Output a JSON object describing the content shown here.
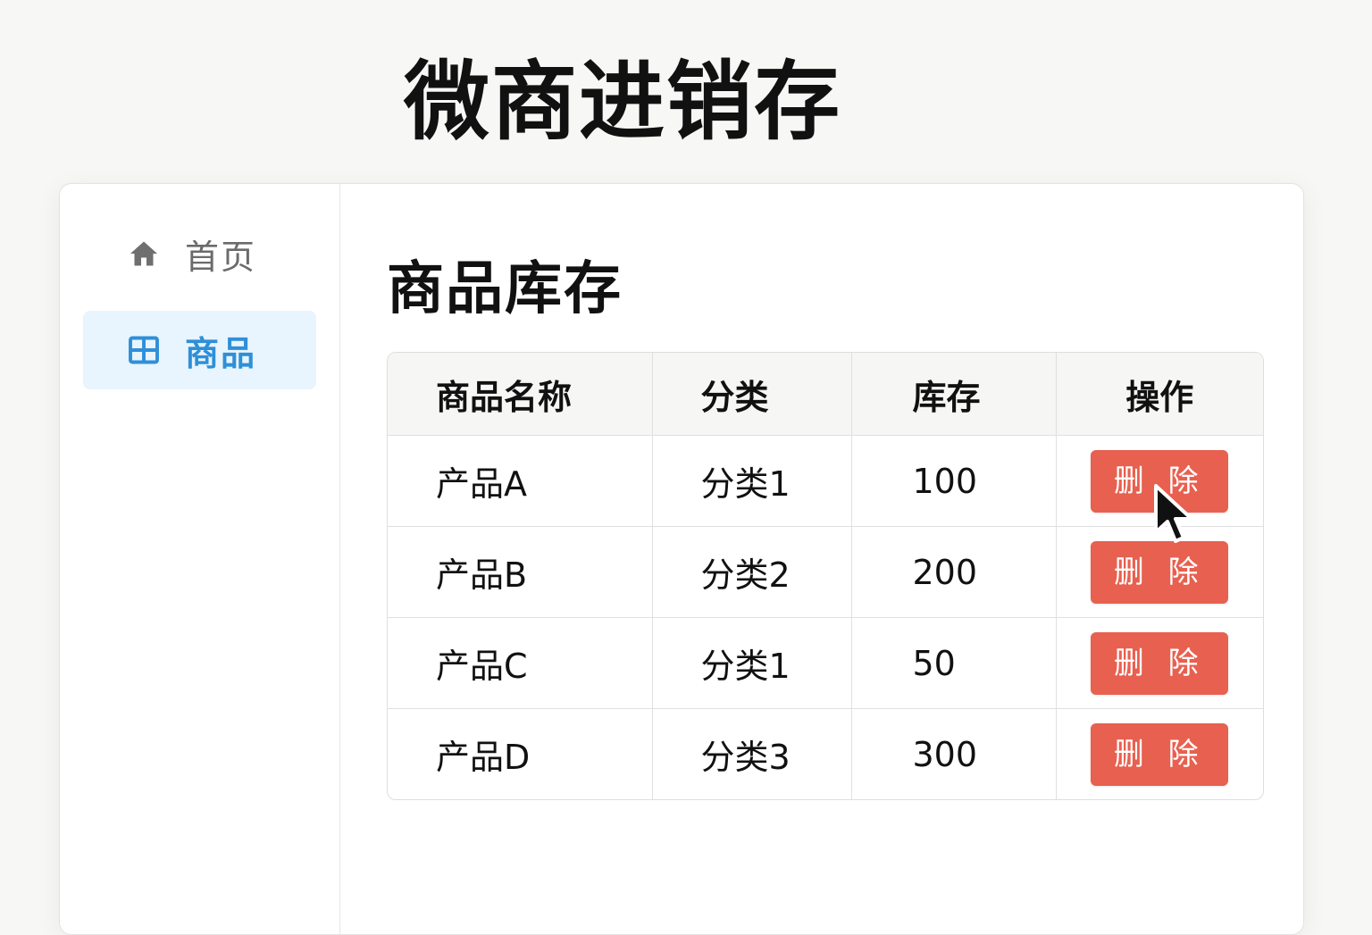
{
  "app": {
    "title": "微商进销存"
  },
  "sidebar": {
    "items": [
      {
        "label": "首页",
        "icon": "home-icon",
        "active": false
      },
      {
        "label": "商品",
        "icon": "grid-icon",
        "active": true
      }
    ]
  },
  "main": {
    "title": "商品库存",
    "table": {
      "headers": [
        "商品名称",
        "分类",
        "库存",
        "操作"
      ],
      "rows": [
        {
          "name": "产品A",
          "category": "分类1",
          "stock": "100",
          "action": "删 除"
        },
        {
          "name": "产品B",
          "category": "分类2",
          "stock": "200",
          "action": "删 除"
        },
        {
          "name": "产品C",
          "category": "分类1",
          "stock": "50",
          "action": "删 除"
        },
        {
          "name": "产品D",
          "category": "分类3",
          "stock": "300",
          "action": "删 除"
        }
      ]
    }
  },
  "colors": {
    "accent": "#2f8fd8",
    "active_bg": "#e8f4fe",
    "danger": "#e8604f"
  }
}
